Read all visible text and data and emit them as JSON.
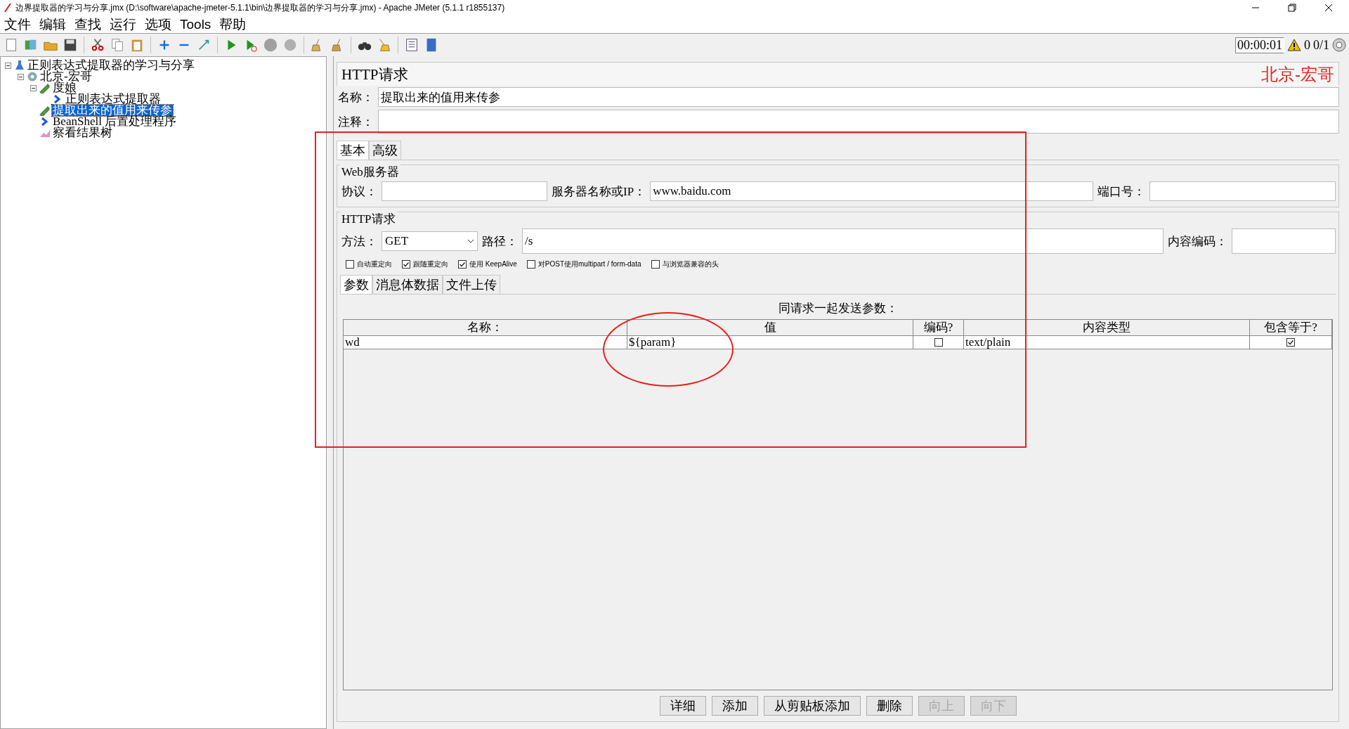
{
  "window": {
    "title": "边界提取器的学习与分享.jmx (D:\\software\\apache-jmeter-5.1.1\\bin\\边界提取器的学习与分享.jmx) - Apache JMeter (5.1.1 r1855137)"
  },
  "menu": [
    "文件",
    "编辑",
    "查找",
    "运行",
    "选项",
    "Tools",
    "帮助"
  ],
  "status": {
    "timer": "00:00:01",
    "warnings": "0",
    "threads": "0/1"
  },
  "tree": [
    {
      "label": "正则表达式提取器的学习与分享",
      "kind": "plan",
      "expanded": true,
      "selected": false,
      "children": [
        {
          "label": "北京-宏哥",
          "kind": "threads",
          "expanded": true,
          "selected": false,
          "children": [
            {
              "label": "度娘",
              "kind": "sampler",
              "expanded": true,
              "selected": false,
              "children": [
                {
                  "label": "正则表达式提取器",
                  "kind": "post",
                  "selected": false
                }
              ]
            },
            {
              "label": "提取出来的值用来传参",
              "kind": "sampler",
              "selected": true
            },
            {
              "label": "BeanShell 后置处理程序",
              "kind": "post",
              "selected": false
            },
            {
              "label": "察看结果树",
              "kind": "listener",
              "selected": false
            }
          ]
        }
      ]
    }
  ],
  "panel": {
    "title": "HTTP请求",
    "author_label": "北京-宏哥",
    "name_label": "名称：",
    "name_value": "提取出来的值用来传参",
    "comment_label": "注释："
  },
  "tabs": [
    {
      "label": "基本",
      "selected": true
    },
    {
      "label": "高级",
      "selected": false
    }
  ],
  "web_server": {
    "legend": "Web服务器",
    "protocol_label": "协议：",
    "server_label": "服务器名称或IP：",
    "server_value": "www.baidu.com",
    "port_label": "端口号："
  },
  "http_request": {
    "legend": "HTTP请求",
    "method_label": "方法：",
    "method_value": "GET",
    "path_label": "路径：",
    "path_value": "/s",
    "encoding_label": "内容编码："
  },
  "options": [
    {
      "label": "自动重定向",
      "checked": false
    },
    {
      "label": "跟随重定向",
      "checked": true
    },
    {
      "label": "使用 KeepAlive",
      "checked": true
    },
    {
      "label": "对POST使用multipart / form-data",
      "checked": false
    },
    {
      "label": "与浏览器兼容的头",
      "checked": false
    }
  ],
  "body_tabs": [
    {
      "label": "参数",
      "selected": true
    },
    {
      "label": "消息体数据",
      "selected": false
    },
    {
      "label": "文件上传",
      "selected": false
    }
  ],
  "params": {
    "caption": "同请求一起发送参数：",
    "columns": [
      "名称：",
      "值",
      "编码?",
      "内容类型",
      "包含等于?"
    ],
    "rows": [
      {
        "name": "wd",
        "value": "${param}",
        "encode": false,
        "content_type": "text/plain",
        "include_equals": true
      }
    ]
  },
  "buttons": [
    {
      "label": "详细",
      "disabled": false
    },
    {
      "label": "添加",
      "disabled": false
    },
    {
      "label": "从剪贴板添加",
      "disabled": false
    },
    {
      "label": "删除",
      "disabled": false
    },
    {
      "label": "向上",
      "disabled": true
    },
    {
      "label": "向下",
      "disabled": true
    }
  ]
}
